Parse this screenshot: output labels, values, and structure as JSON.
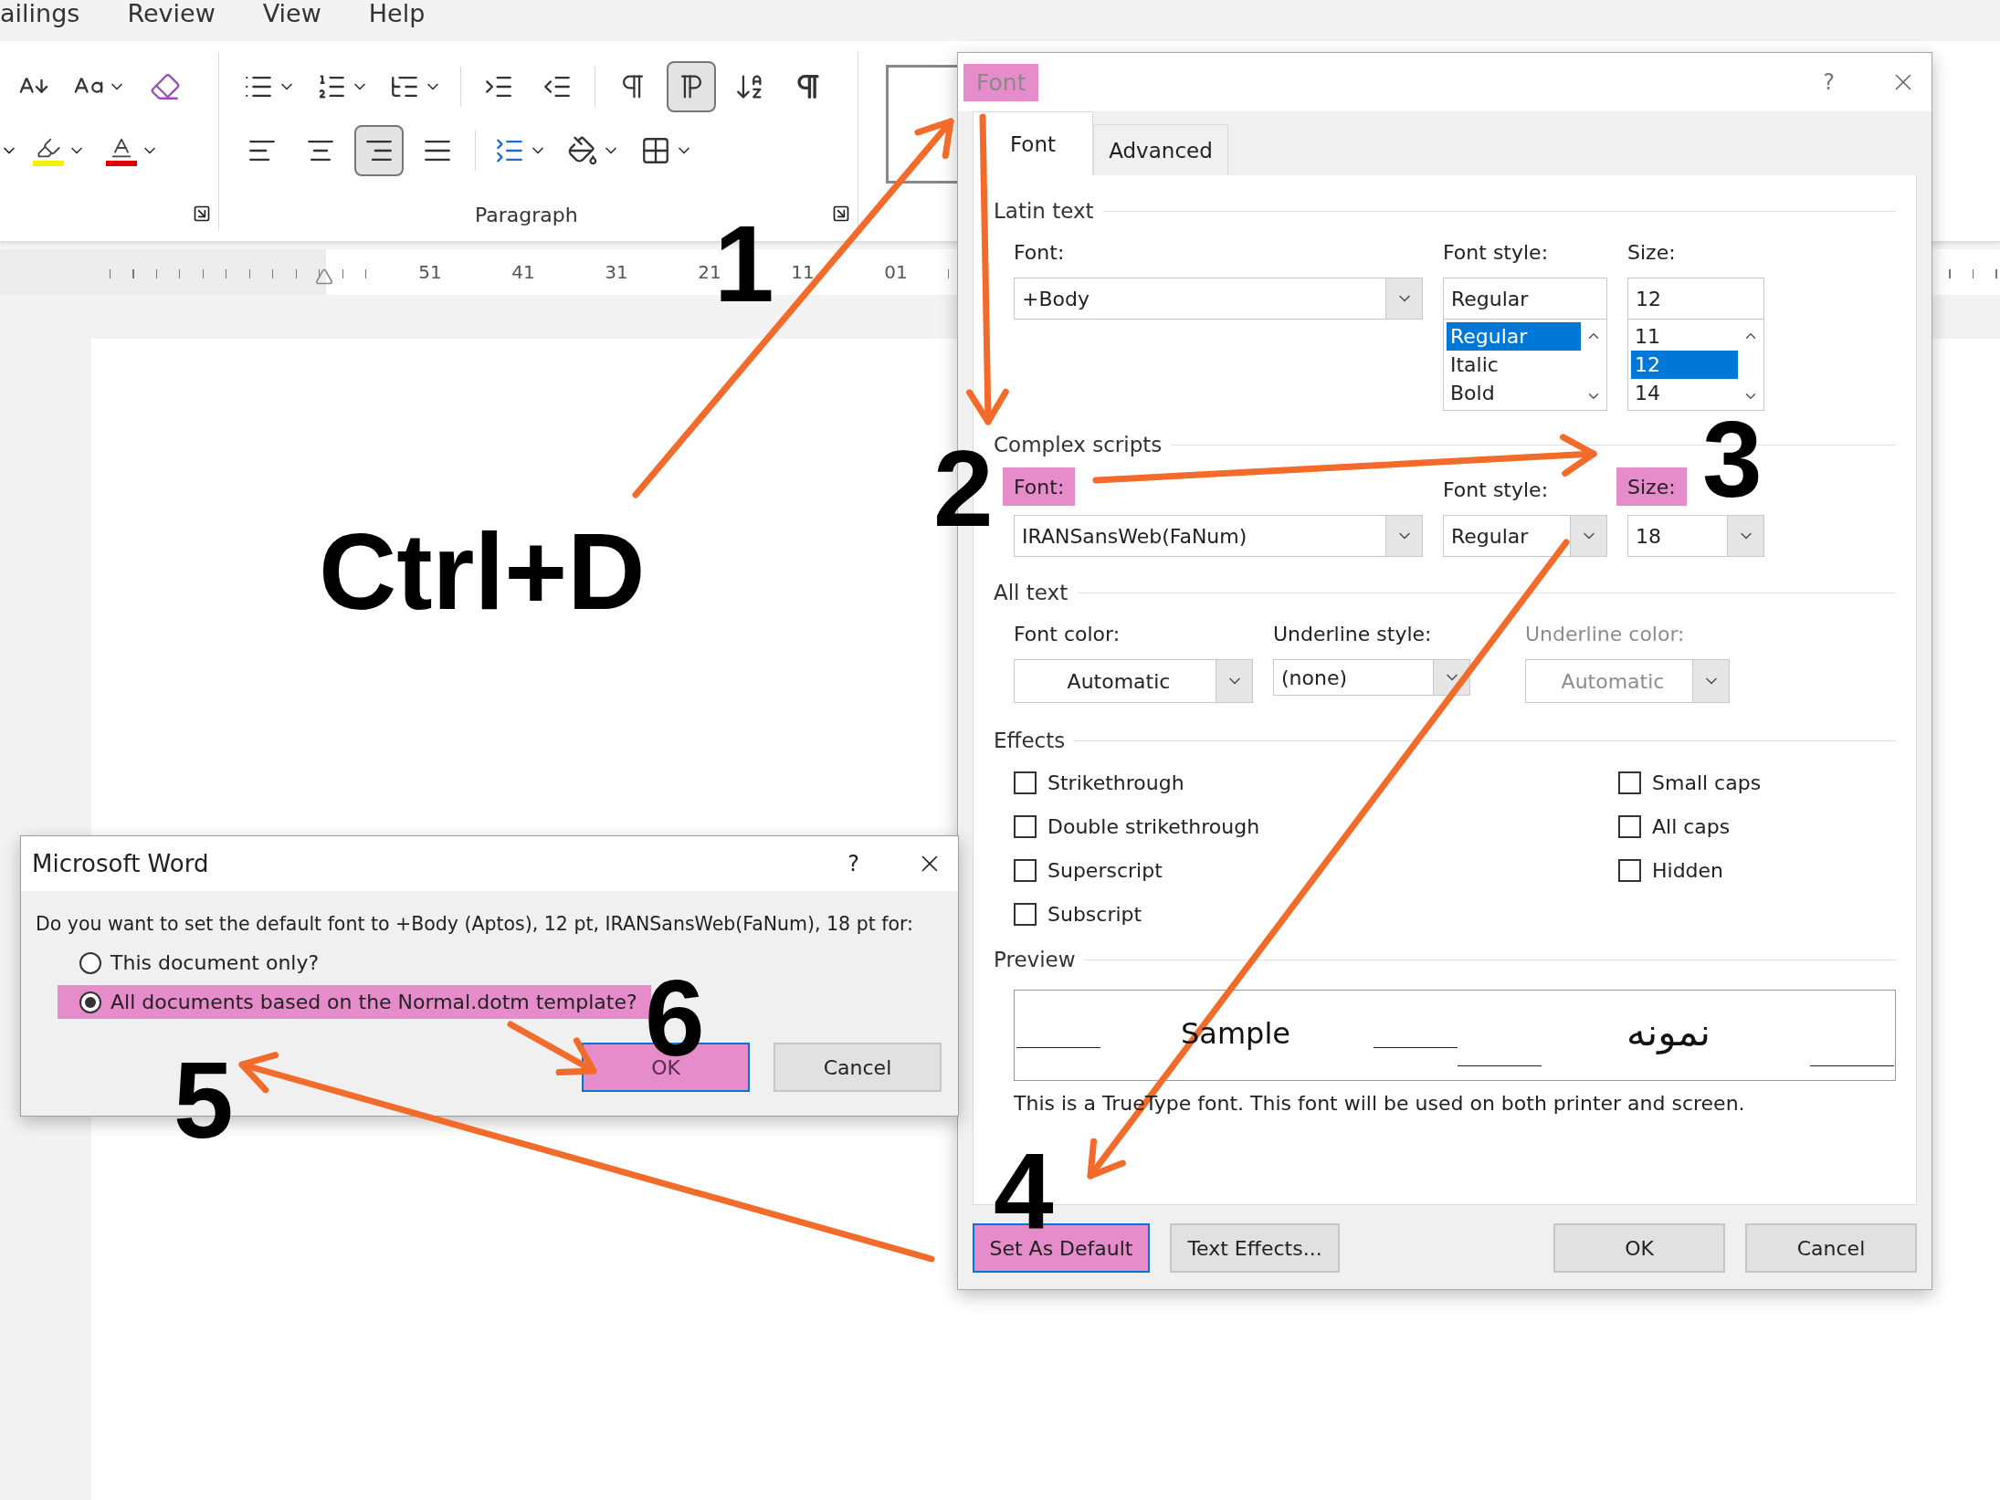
{
  "menu_bar": {
    "items": [
      "ailings",
      "Review",
      "View",
      "Help"
    ]
  },
  "ribbon": {
    "group_label": "Paragraph",
    "direction": [
      {
        "selected": false
      },
      {
        "selected": true
      }
    ],
    "alignment": [
      {
        "selected": false
      },
      {
        "selected": false
      },
      {
        "selected": true
      },
      {
        "selected": false
      }
    ]
  },
  "ruler": {
    "numbers": [
      "51",
      "41",
      "31",
      "21",
      "11",
      "01"
    ]
  },
  "document": {
    "text": "Ctrl+D"
  },
  "font_dialog": {
    "title": "Font",
    "title_highlighted": true,
    "help": "?",
    "tabs": [
      {
        "label": "Font",
        "selected": true
      },
      {
        "label": "Advanced",
        "selected": false
      }
    ],
    "latin": {
      "heading": "Latin text",
      "font_label": "Font:",
      "font_value": "+Body",
      "style_label": "Font style:",
      "style_value": "Regular",
      "size_label": "Size:",
      "size_value": "12",
      "style_options": [
        {
          "label": "Regular",
          "selected": true
        },
        {
          "label": "Italic",
          "selected": false
        },
        {
          "label": "Bold",
          "selected": false
        }
      ],
      "size_options": [
        {
          "label": "11",
          "selected": false
        },
        {
          "label": "12",
          "selected": true
        },
        {
          "label": "14",
          "selected": false
        }
      ]
    },
    "complex": {
      "heading": "Complex scripts",
      "font_label": "Font:",
      "font_label_highlighted": true,
      "font_value": "IRANSansWeb(FaNum)",
      "style_label": "Font style:",
      "style_value": "Regular",
      "size_label": "Size:",
      "size_label_highlighted": true,
      "size_value": "18"
    },
    "all_text": {
      "heading": "All text",
      "fields": [
        {
          "label": "Font color:",
          "value": "Automatic",
          "disabled": false
        },
        {
          "label": "Underline style:",
          "value": "(none)",
          "disabled": false
        },
        {
          "label": "Underline color:",
          "value": "Automatic",
          "disabled": true
        }
      ]
    },
    "effects": {
      "heading": "Effects",
      "left": [
        {
          "label": "Strikethrough",
          "checked": false
        },
        {
          "label": "Double strikethrough",
          "checked": false
        },
        {
          "label": "Superscript",
          "checked": false
        },
        {
          "label": "Subscript",
          "checked": false
        }
      ],
      "right": [
        {
          "label": "Small caps",
          "checked": false
        },
        {
          "label": "All caps",
          "checked": false
        },
        {
          "label": "Hidden",
          "checked": false
        }
      ]
    },
    "preview": {
      "heading": "Preview",
      "sample": "Sample",
      "sample_rtl": "نمونه",
      "note": "This is a TrueType font. This font will be used on both printer and screen."
    },
    "buttons": [
      {
        "label": "Set As Default",
        "highlighted": true
      },
      {
        "label": "Text Effects...",
        "highlighted": false
      },
      {
        "label": "OK",
        "highlighted": false
      },
      {
        "label": "Cancel",
        "highlighted": false
      }
    ]
  },
  "word_dialog": {
    "title": "Microsoft Word",
    "help": "?",
    "question": "Do you want to set the default font to +Body (Aptos), 12 pt, IRANSansWeb(FaNum), 18 pt for:",
    "options": [
      {
        "label": "This document only?",
        "selected": false,
        "highlighted": false
      },
      {
        "label": "All documents based on the Normal.dotm template?",
        "selected": true,
        "highlighted": true
      }
    ],
    "buttons": [
      {
        "label": "OK",
        "highlighted": true
      },
      {
        "label": "Cancel",
        "highlighted": false
      }
    ]
  },
  "annotations": {
    "steps": [
      "1",
      "2",
      "3",
      "4",
      "5",
      "6"
    ]
  }
}
